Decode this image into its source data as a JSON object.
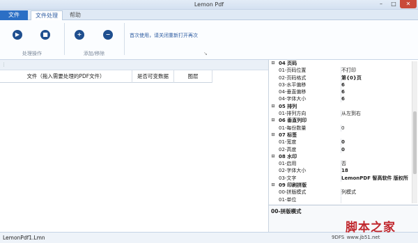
{
  "window": {
    "title": "Lemon Pdf",
    "min": "–",
    "max": "□",
    "close": "✕"
  },
  "tabs": [
    {
      "label": "文件"
    },
    {
      "label": "文件处理"
    },
    {
      "label": "帮助"
    }
  ],
  "ribbon": {
    "start_glyph": "▶",
    "stop_glyph": "■",
    "add_glyph": "+",
    "remove_glyph": "−",
    "group1_label": "处理操作",
    "group2_label": "添加/移除",
    "note": "首次使用，请关闭重新打开再次",
    "launcher": "↘"
  },
  "strip": {
    "grip": "⋮"
  },
  "grid": {
    "columns": [
      "文件（拖入需要处理的PDF文件）",
      "是否可变数据",
      "图层"
    ]
  },
  "properties": {
    "rows": [
      {
        "type": "cat",
        "name": "04 页码"
      },
      {
        "type": "item",
        "key": "01-页码位置",
        "value": "不打印"
      },
      {
        "type": "item",
        "key": "02-页码格式",
        "value": "第{0}页",
        "bold": true
      },
      {
        "type": "item",
        "key": "03-水平偏移",
        "value": "6",
        "bold": true
      },
      {
        "type": "item",
        "key": "04-垂直偏移",
        "value": "6",
        "bold": true
      },
      {
        "type": "item",
        "key": "04-字体大小",
        "value": "6",
        "bold": true
      },
      {
        "type": "cat",
        "name": "05 排列"
      },
      {
        "type": "item",
        "key": "01-排列方向",
        "value": "从左到右"
      },
      {
        "type": "cat",
        "name": "06 垂直列印"
      },
      {
        "type": "item",
        "key": "01-每份数量",
        "value": "0"
      },
      {
        "type": "cat",
        "name": "07 标签"
      },
      {
        "type": "item",
        "key": "01-宽度",
        "value": "0",
        "bold": true
      },
      {
        "type": "item",
        "key": "02-高度",
        "value": "0",
        "bold": true
      },
      {
        "type": "cat",
        "name": "08 水印"
      },
      {
        "type": "item",
        "key": "01-启用",
        "value": "否"
      },
      {
        "type": "item",
        "key": "02-字体大小",
        "value": "18",
        "bold": true
      },
      {
        "type": "item",
        "key": "03-文字",
        "value": "LemonPDF 智高软件 版权所",
        "bold": true
      },
      {
        "type": "cat",
        "name": "09 印刷拼版"
      },
      {
        "type": "item",
        "key": "00-拼版模式",
        "value": "列模式"
      },
      {
        "type": "item",
        "key": "01-单位",
        "value": ""
      }
    ],
    "expand_glyph": "⊟"
  },
  "description": {
    "title": "00-拼版模式"
  },
  "status": {
    "file": "LemonPdf1.Lmn",
    "right": "9DFS www.jb51.net"
  },
  "watermark": {
    "text": "脚本之家"
  }
}
